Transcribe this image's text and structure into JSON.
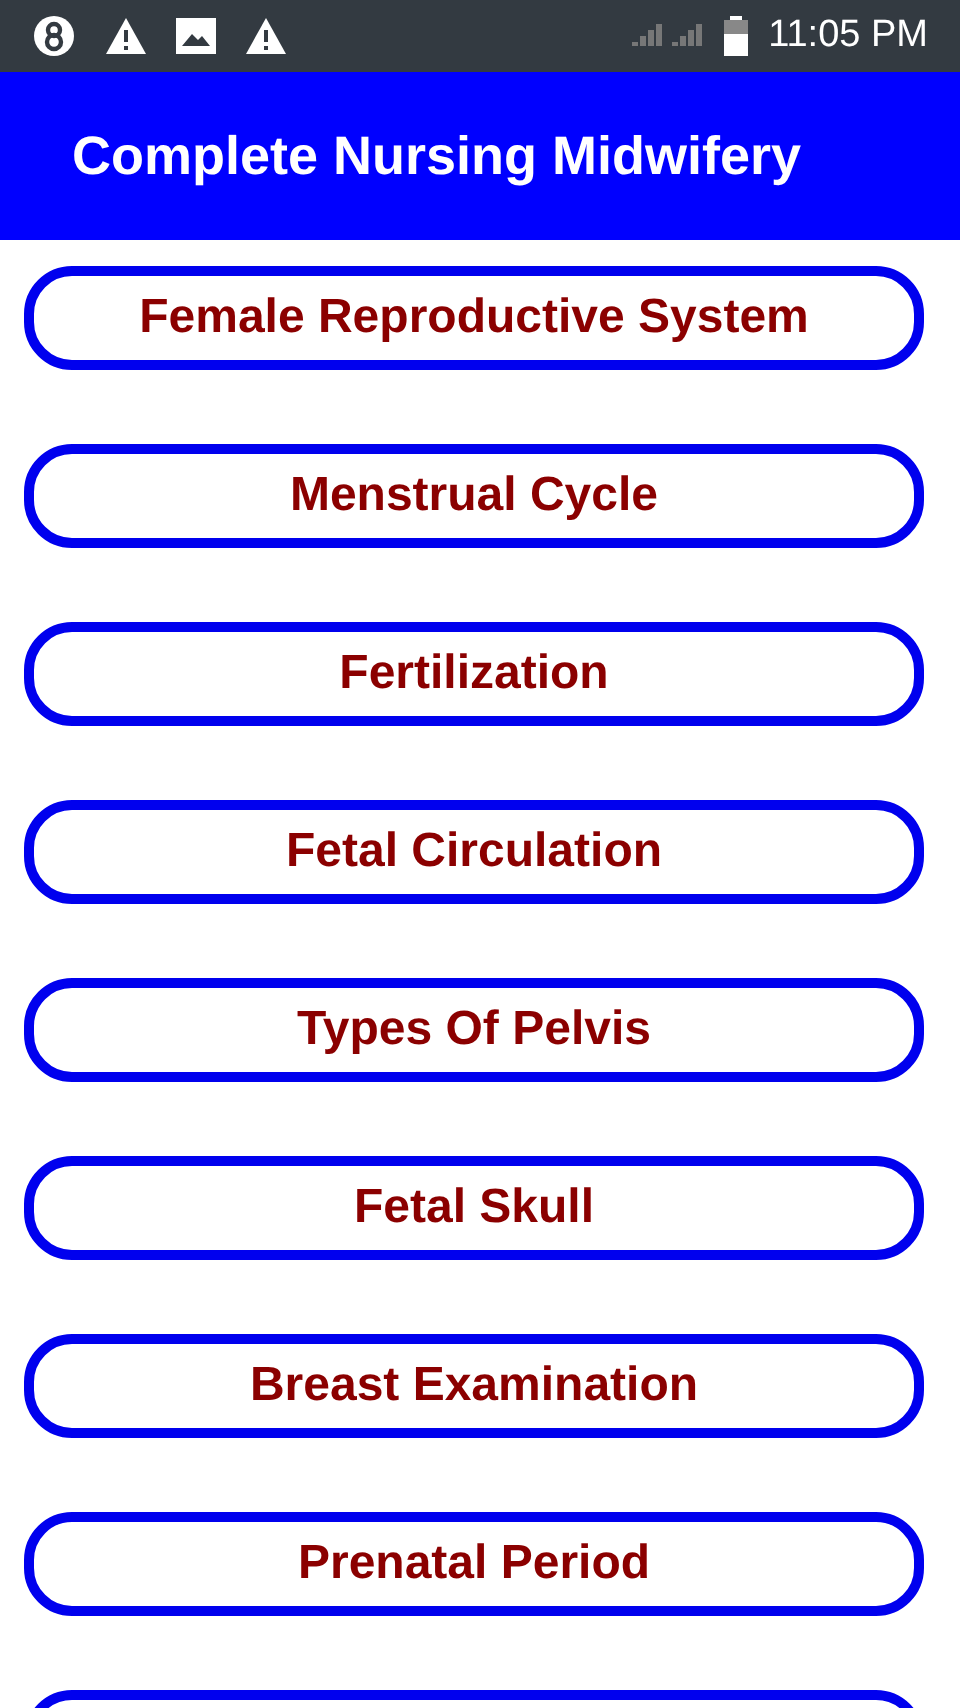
{
  "status_bar": {
    "time": "11:05 PM"
  },
  "app_bar": {
    "title": "Complete Nursing Midwifery"
  },
  "topics": [
    {
      "label": "Female Reproductive System"
    },
    {
      "label": "Menstrual Cycle"
    },
    {
      "label": "Fertilization"
    },
    {
      "label": "Fetal Circulation"
    },
    {
      "label": "Types Of Pelvis"
    },
    {
      "label": "Fetal Skull"
    },
    {
      "label": "Breast Examination"
    },
    {
      "label": "Prenatal Period"
    }
  ],
  "more_below": true
}
